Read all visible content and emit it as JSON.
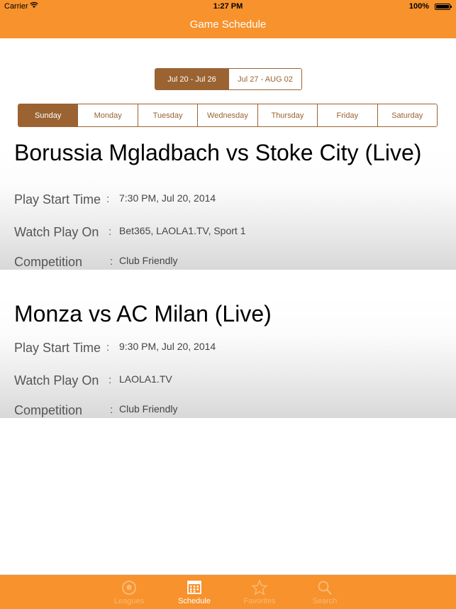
{
  "status_bar": {
    "carrier": "Carrier",
    "time": "1:27 PM",
    "battery": "100%"
  },
  "nav": {
    "title": "Game Schedule"
  },
  "week_selector": [
    "Jul 20 - Jul 26",
    "Jul 27 - AUG 02"
  ],
  "day_selector": [
    "Sunday",
    "Monday",
    "Tuesday",
    "Wednesday",
    "Thursday",
    "Friday",
    "Saturday"
  ],
  "games": [
    {
      "title": "Borussia Mgladbach vs Stoke City (Live)",
      "start_label": "Play Start Time",
      "start_value": "7:30 PM, Jul 20, 2014",
      "watch_label": "Watch Play On",
      "watch_value": "Bet365, LAOLA1.TV, Sport 1",
      "competition_label": "Competition",
      "competition_value": "Club Friendly",
      "colon": ":"
    },
    {
      "title": "Monza vs AC Milan (Live)",
      "start_label": "Play Start Time",
      "start_value": "9:30 PM, Jul 20, 2014",
      "watch_label": "Watch Play On",
      "watch_value": "LAOLA1.TV",
      "competition_label": "Competition",
      "competition_value": "Club Friendly",
      "colon": ":"
    }
  ],
  "tabs": [
    {
      "label": "Leagues",
      "icon": "soccer-ball-icon"
    },
    {
      "label": "Schedule",
      "icon": "calendar-icon"
    },
    {
      "label": "Favorites",
      "icon": "star-icon"
    },
    {
      "label": "Search",
      "icon": "search-icon"
    }
  ],
  "colors": {
    "brand_orange": "#f7922c",
    "accent_brown": "#9a6331"
  }
}
